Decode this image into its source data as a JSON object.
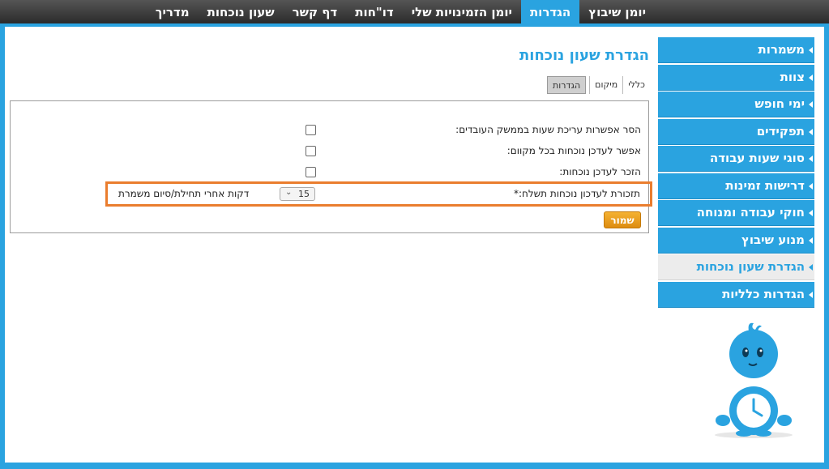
{
  "nav": {
    "items": [
      {
        "label": "יומן שיבוץ"
      },
      {
        "label": "הגדרות"
      },
      {
        "label": "יומן הזמינויות שלי"
      },
      {
        "label": "דו\"חות"
      },
      {
        "label": "דף קשר"
      },
      {
        "label": "שעון נוכחות"
      },
      {
        "label": "מדריך"
      }
    ],
    "active": "הגדרות"
  },
  "sidebar": {
    "items": [
      {
        "label": "משמרות"
      },
      {
        "label": "צוות"
      },
      {
        "label": "ימי חופש"
      },
      {
        "label": "תפקידים"
      },
      {
        "label": "סוגי שעות עבודה"
      },
      {
        "label": "דרישות זמינות"
      },
      {
        "label": "חוקי עבודה ומנוחה"
      },
      {
        "label": "מנוע שיבוץ"
      },
      {
        "label": "הגדרת שעון נוכחות"
      },
      {
        "label": "הגדרות כלליות"
      }
    ],
    "active": "הגדרת שעון נוכחות"
  },
  "page": {
    "title": "הגדרת שעון נוכחות",
    "tabs": [
      {
        "label": "כללי"
      },
      {
        "label": "מיקום"
      },
      {
        "label": "הגדרות"
      }
    ],
    "active_tab": "הגדרות"
  },
  "form": {
    "rows": [
      {
        "label": "הסר אפשרות עריכת שעות בממשק העובדים:",
        "checked": false
      },
      {
        "label": "אפשר לעדכן נוכחות בכל מקוום:",
        "checked": false
      },
      {
        "label": "הזכר לעדכן נוכחות:",
        "checked": false
      }
    ],
    "reminder_label": "תזכורת לעדכון נוכחות תשלח:*",
    "reminder_value": "15",
    "reminder_unit": "דקות אחרי תחילת/סיום משמרת",
    "save_label": "שמור"
  },
  "colors": {
    "accent": "#2aa3e0",
    "highlight": "#ea7d2e",
    "save_button": "#e9a020"
  },
  "icons": {
    "mascot": "clock-mascot-icon",
    "chevron": "chevron-down-icon",
    "arrow": "arrow-left-icon"
  }
}
